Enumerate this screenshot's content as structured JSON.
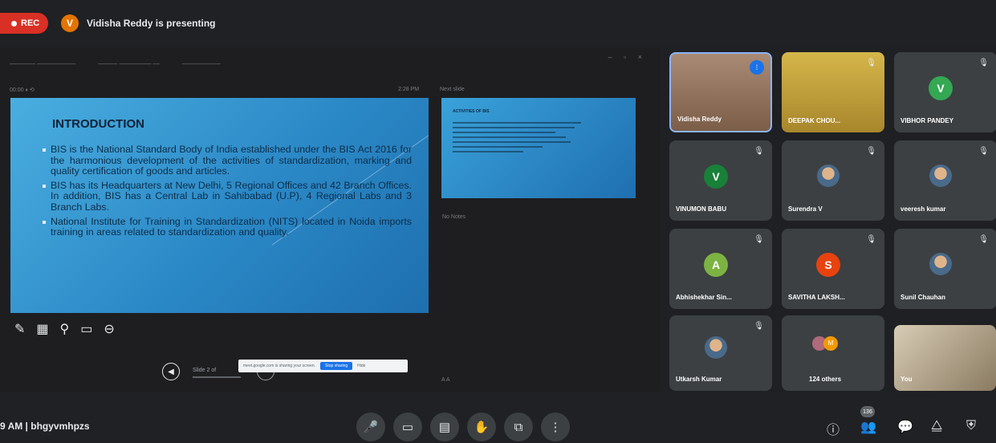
{
  "header": {
    "rec_label": "REC",
    "presenter_initial": "V",
    "presenter_text": "Vidisha Reddy is presenting"
  },
  "presentation": {
    "toolbar": [
      "———— ——————",
      "——— ————— —",
      "——————"
    ],
    "window_controls": "– ▫ ×",
    "slide_meta": "00:00  ⏸  ⟲",
    "slide_time": "2:28 PM",
    "next_label": "Next slide",
    "slide": {
      "title": "INTRODUCTION",
      "bullets": [
        "BIS is the National Standard Body of India established under the BIS Act 2016 for the harmonious development of the activities of standardization, marking and quality certification of goods and articles.",
        "BIS has its Headquarters at New Delhi, 5 Regional Offices and 42 Branch Offices. In addition, BIS has a Central Lab in Sahibabad (U.P), 4 Regional Labs and 3 Branch Labs.",
        "National Institute for Training in Standardization (NITS) located in Noida imports training in areas related to standardization and quality."
      ]
    },
    "next_slide_title": "ACTIVITIES OF BIS",
    "notes_label": "No Notes",
    "nav_label": "Slide 2 of",
    "share_banner_text": "meet.google.com is sharing your screen.",
    "share_stop_label": "Stop sharing",
    "share_hide_label": "Hide",
    "bottom_small": "A  A"
  },
  "participants": [
    {
      "name": "Vidisha Reddy",
      "kind": "video"
    },
    {
      "name": "DEEPAK CHOU...",
      "kind": "video"
    },
    {
      "name": "VIBHOR PANDEY",
      "initial": "V",
      "color": "#34a853"
    },
    {
      "name": "VINUMON BABU",
      "initial": "V",
      "color": "#188038"
    },
    {
      "name": "Surendra V",
      "kind": "photo"
    },
    {
      "name": "veeresh kumar",
      "kind": "photo"
    },
    {
      "name": "Abhishekhar Sin...",
      "initial": "A",
      "color": "#7cb342"
    },
    {
      "name": "SAVITHA LAKSH...",
      "initial": "S",
      "color": "#e8430f"
    },
    {
      "name": "Sunil Chauhan",
      "kind": "photo"
    },
    {
      "name": "Utkarsh Kumar",
      "kind": "photo"
    },
    {
      "name": "124 others",
      "kind": "others"
    },
    {
      "name": "You",
      "kind": "self"
    }
  ],
  "others_avatar_initial": "M",
  "footer": {
    "meeting_info": "9 AM  |  bhgyvmhpzs",
    "people_count": "136"
  }
}
